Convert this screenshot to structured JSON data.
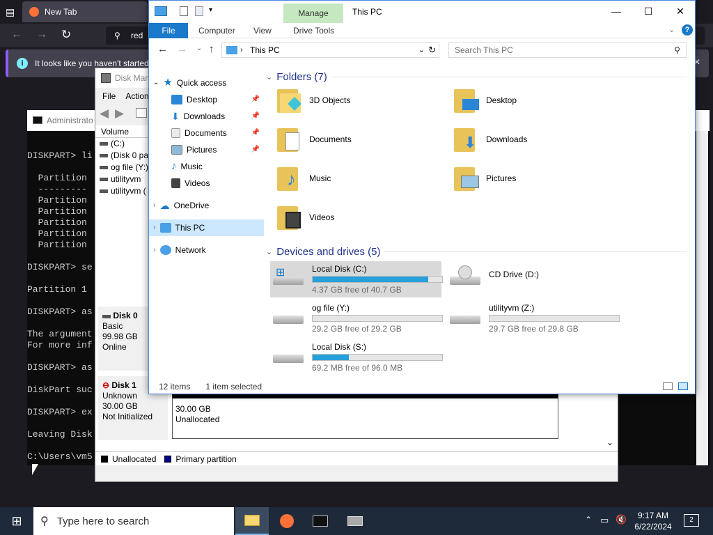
{
  "firefox": {
    "tab_title": "New Tab",
    "url_text": "red",
    "notification": "It looks like you haven't started F"
  },
  "console": {
    "title": "Administrato",
    "lines": [
      "DISKPART> li",
      "",
      "  Partition",
      "  ---------",
      "  Partition",
      "  Partition",
      "  Partition",
      "  Partition",
      "  Partition",
      "",
      "DISKPART> se",
      "",
      "Partition 1",
      "",
      "DISKPART> as",
      "",
      "The argument",
      "For more inf",
      "",
      "DISKPART> as",
      "",
      "DiskPart suc",
      "",
      "DISKPART> ex",
      "",
      "Leaving Disk",
      "",
      "C:\\Users\\vm5"
    ]
  },
  "diskmgmt": {
    "title": "Disk Man",
    "menu": [
      "File",
      "Action"
    ],
    "volume_header": "Volume",
    "volumes": [
      "(C:)",
      "(Disk 0 par",
      "og file (Y:)",
      "utilityvm",
      "utilityvm ("
    ],
    "disk0": {
      "name": "Disk 0",
      "type": "Basic",
      "size": "99.98 GB",
      "status": "Online"
    },
    "disk1": {
      "name": "Disk 1",
      "type": "Unknown",
      "size": "30.00 GB",
      "status": "Not Initialized"
    },
    "unallocated": {
      "size": "30.00 GB",
      "label": "Unallocated"
    },
    "legend": [
      "Unallocated",
      "Primary partition"
    ]
  },
  "explorer": {
    "title": "This PC",
    "manage": "Manage",
    "ribbon": [
      "File",
      "Computer",
      "View",
      "Drive Tools"
    ],
    "address": "This PC",
    "search_placeholder": "Search This PC",
    "nav": {
      "quick": "Quick access",
      "items": [
        "Desktop",
        "Downloads",
        "Documents",
        "Pictures",
        "Music",
        "Videos"
      ],
      "onedrive": "OneDrive",
      "thispc": "This PC",
      "network": "Network"
    },
    "folders_header": "Folders (7)",
    "folders": [
      "3D Objects",
      "Desktop",
      "Documents",
      "Downloads",
      "Music",
      "Pictures",
      "Videos"
    ],
    "drives_header": "Devices and drives (5)",
    "drives": [
      {
        "name": "Local Disk (C:)",
        "free": "4.37 GB free of 40.7 GB",
        "used_fraction": 0.89
      },
      {
        "name": "CD Drive (D:)",
        "free": "",
        "used_fraction": 0
      },
      {
        "name": "og file (Y:)",
        "free": "29.2 GB free of 29.2 GB",
        "used_fraction": 0.0
      },
      {
        "name": "utilityvm (Z:)",
        "free": "29.7 GB free of 29.8 GB",
        "used_fraction": 0.0
      },
      {
        "name": "Local Disk (S:)",
        "free": "69.2 MB free of 96.0 MB",
        "used_fraction": 0.28
      }
    ],
    "status": {
      "items": "12 items",
      "selected": "1 item selected"
    }
  },
  "taskbar": {
    "search": "Type here to search",
    "time": "9:17 AM",
    "date": "6/22/2024",
    "notif_count": "2"
  }
}
